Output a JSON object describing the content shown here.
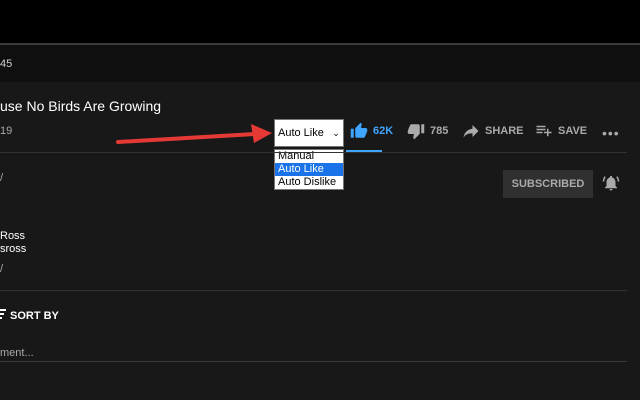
{
  "player": {
    "time_fragment": "45"
  },
  "video": {
    "title": "use No Birds Are Growing",
    "date_fragment": "19"
  },
  "mode_select": {
    "selected": "Auto Like",
    "options": [
      "Manual",
      "Auto Like",
      "Auto Dislike"
    ]
  },
  "actions": {
    "like_count": "62K",
    "dislike_count": "785",
    "share_label": "SHARE",
    "save_label": "SAVE",
    "more_label": "•••"
  },
  "channel": {
    "fragment": "/",
    "subscribe_label": "SUBSCRIBED"
  },
  "description": {
    "line1": "Ross",
    "line2": "sross",
    "line3": "/"
  },
  "comments": {
    "sort_icon": "/",
    "sort_label": "SORT BY",
    "placeholder": "ment..."
  },
  "colors": {
    "background": "#181818",
    "accent_blue": "#3ea6ff",
    "annotation_arrow": "#e53935",
    "selection_blue": "#1a73e8"
  },
  "icons": [
    "thumbs-up-icon",
    "thumbs-down-icon",
    "share-icon",
    "playlist-add-icon",
    "more-icon",
    "bell-icon",
    "annotation-arrow"
  ]
}
